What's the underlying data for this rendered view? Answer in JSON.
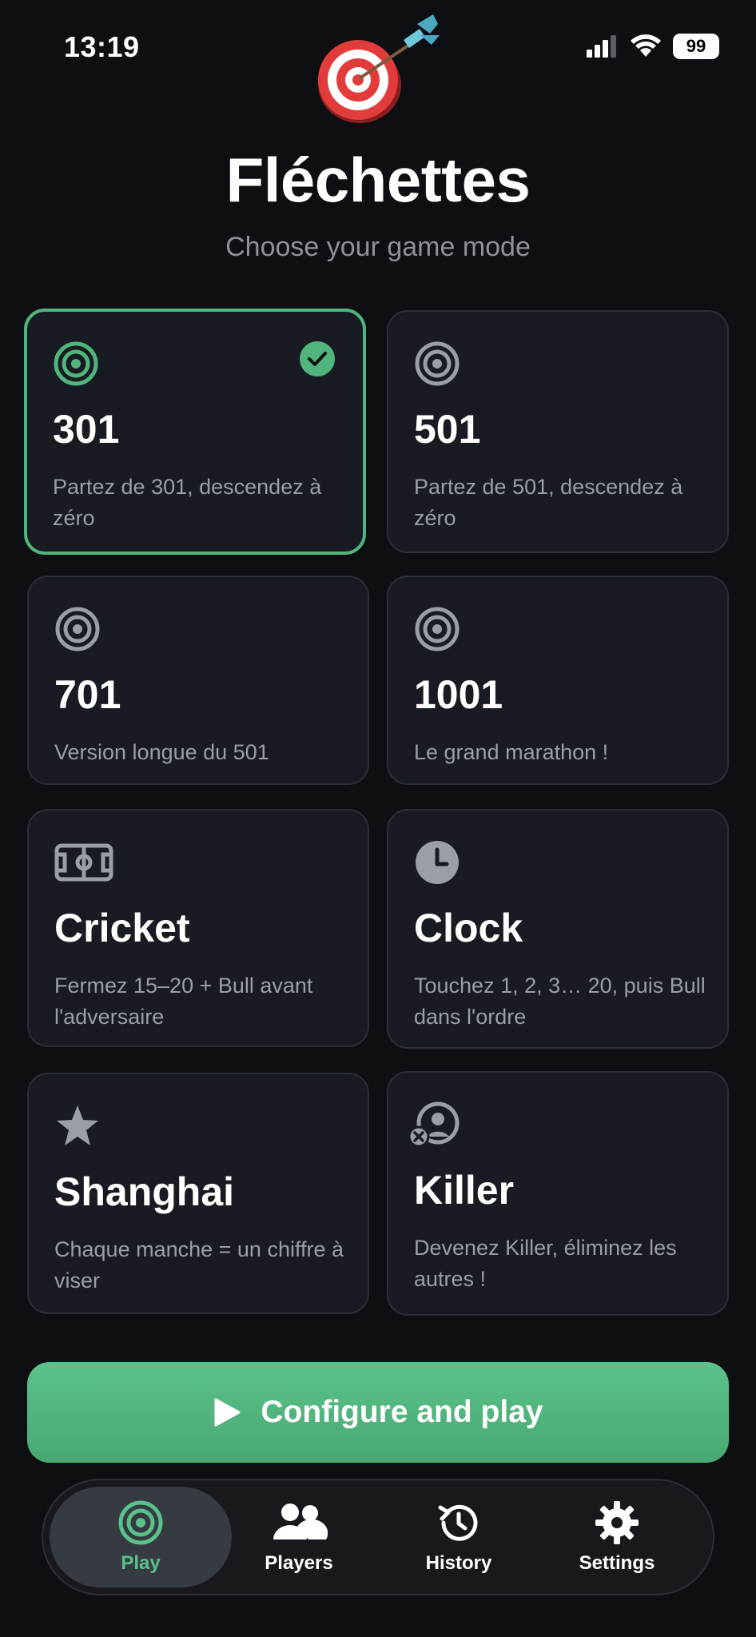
{
  "status": {
    "time": "13:19",
    "battery": "99"
  },
  "header": {
    "title": "Fléchettes",
    "subtitle": "Choose your game mode"
  },
  "modes": [
    {
      "name": "301",
      "desc": "Partez de 301, descendez à zéro",
      "icon": "target-icon",
      "selected": true
    },
    {
      "name": "501",
      "desc": "Partez de 501, descendez à zéro",
      "icon": "target-icon",
      "selected": false
    },
    {
      "name": "701",
      "desc": "Version longue du 501",
      "icon": "target-icon",
      "selected": false
    },
    {
      "name": "1001",
      "desc": "Le grand marathon !",
      "icon": "target-icon",
      "selected": false
    },
    {
      "name": "Cricket",
      "desc": "Fermez 15–20 + Bull avant l'adversaire",
      "icon": "field-icon",
      "selected": false
    },
    {
      "name": "Clock",
      "desc": "Touchez 1, 2, 3… 20, puis Bull dans l'ordre",
      "icon": "clock-icon",
      "selected": false
    },
    {
      "name": "Shanghai",
      "desc": "Chaque manche = un chiffre à viser",
      "icon": "star-icon",
      "selected": false
    },
    {
      "name": "Killer",
      "desc": "Devenez Killer, éliminez les autres !",
      "icon": "user-x-icon",
      "selected": false
    }
  ],
  "cta": {
    "label": "Configure and play"
  },
  "tabs": [
    {
      "label": "Play",
      "icon": "target-icon",
      "active": true
    },
    {
      "label": "Players",
      "icon": "users-icon",
      "active": false
    },
    {
      "label": "History",
      "icon": "history-icon",
      "active": false
    },
    {
      "label": "Settings",
      "icon": "gear-icon",
      "active": false
    }
  ],
  "colors": {
    "accent": "#4fb57d",
    "background": "#0d0f12",
    "card": "#181b21",
    "muted": "#9a9ea5"
  }
}
